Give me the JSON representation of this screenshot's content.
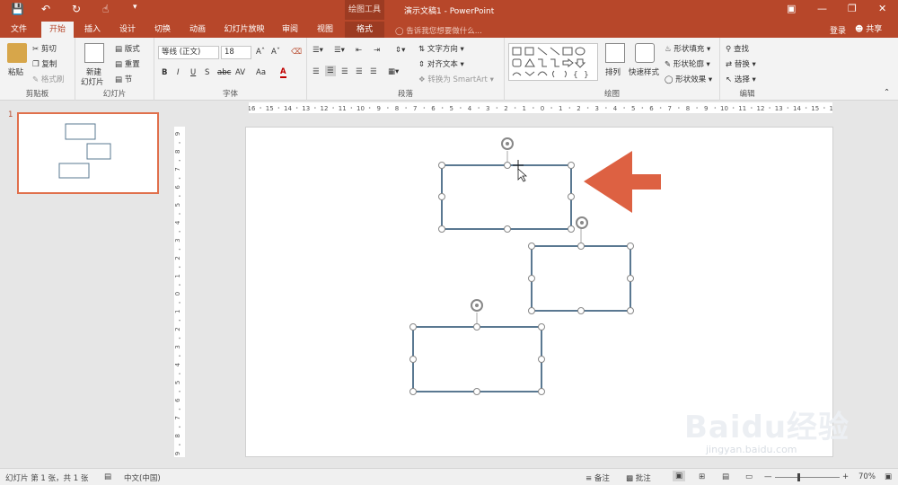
{
  "window": {
    "context_tab": "绘图工具",
    "title": "演示文稿1 - PowerPoint"
  },
  "tabs": [
    "文件",
    "开始",
    "插入",
    "设计",
    "切换",
    "动画",
    "幻灯片放映",
    "审阅",
    "视图",
    "格式"
  ],
  "tell_me": "告诉我您想要做什么...",
  "login": "登录",
  "share": "共享",
  "clipboard": {
    "paste": "粘贴",
    "cut": "剪切",
    "copy": "复制",
    "format_painter": "格式刷",
    "label": "剪贴板"
  },
  "slides_group": {
    "new_slide": "新建",
    "new_slide2": "幻灯片",
    "layout": "版式",
    "reset": "重置",
    "section": "节",
    "label": "幻灯片"
  },
  "font_group": {
    "font_name": "等线 (正文)",
    "font_size": "18",
    "bold": "B",
    "italic": "I",
    "underline": "U",
    "shadow": "S",
    "strike": "abc",
    "spacing": "AV",
    "case": "Aa",
    "label": "字体"
  },
  "paragraph_group": {
    "text_direction": "文字方向",
    "align_text": "对齐文本",
    "smartart": "转换为 SmartArt",
    "label": "段落"
  },
  "drawing_group": {
    "arrange": "排列",
    "quick_styles": "快速样式",
    "fill": "形状填充",
    "outline": "形状轮廓",
    "effects": "形状效果",
    "label": "绘图"
  },
  "editing_group": {
    "find": "查找",
    "replace": "替换",
    "select": "选择",
    "label": "编辑"
  },
  "thumbnail_number": "1",
  "hruler_labels": [
    "16",
    "15",
    "14",
    "13",
    "12",
    "11",
    "10",
    "9",
    "8",
    "7",
    "6",
    "5",
    "4",
    "3",
    "2",
    "1",
    "0",
    "1",
    "2",
    "3",
    "4",
    "5",
    "6",
    "7",
    "8",
    "9",
    "10",
    "11",
    "12",
    "13",
    "14",
    "15",
    "16"
  ],
  "vruler_labels": [
    "9",
    "8",
    "7",
    "6",
    "5",
    "4",
    "3",
    "2",
    "1",
    "0",
    "1",
    "2",
    "3",
    "4",
    "5",
    "6",
    "7",
    "8",
    "9"
  ],
  "status": {
    "slide_info": "幻灯片 第 1 张，共 1 张",
    "language": "中文(中国)",
    "notes": "备注",
    "comments": "批注",
    "zoom": "70%"
  },
  "colors": {
    "accent": "#b7472a",
    "shape_stroke": "#5a7891",
    "arrow": "#dd6142",
    "thumb_border": "#e0704c"
  },
  "watermark": {
    "brand": "Baidu经验",
    "url": "jingyan.baidu.com"
  }
}
